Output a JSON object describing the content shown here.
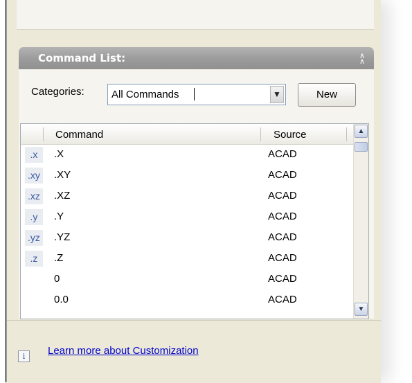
{
  "command_list": {
    "title": "Command List:",
    "categories_label": "Categories:",
    "categories_value": "All Commands",
    "new_button": "New",
    "columns": {
      "command": "Command",
      "source": "Source"
    },
    "rows": [
      {
        "icon": ".x",
        "command": ".X",
        "source": "ACAD"
      },
      {
        "icon": ".xy",
        "command": ".XY",
        "source": "ACAD"
      },
      {
        "icon": ".xz",
        "command": ".XZ",
        "source": "ACAD"
      },
      {
        "icon": ".y",
        "command": ".Y",
        "source": "ACAD"
      },
      {
        "icon": ".yz",
        "command": ".YZ",
        "source": "ACAD"
      },
      {
        "icon": ".z",
        "command": ".Z",
        "source": "ACAD"
      },
      {
        "icon": "",
        "command": "0",
        "source": "ACAD"
      },
      {
        "icon": "",
        "command": "0.0",
        "source": "ACAD"
      }
    ]
  },
  "info": {
    "icon_glyph": "i",
    "link_text": "Learn more about Customization"
  }
}
